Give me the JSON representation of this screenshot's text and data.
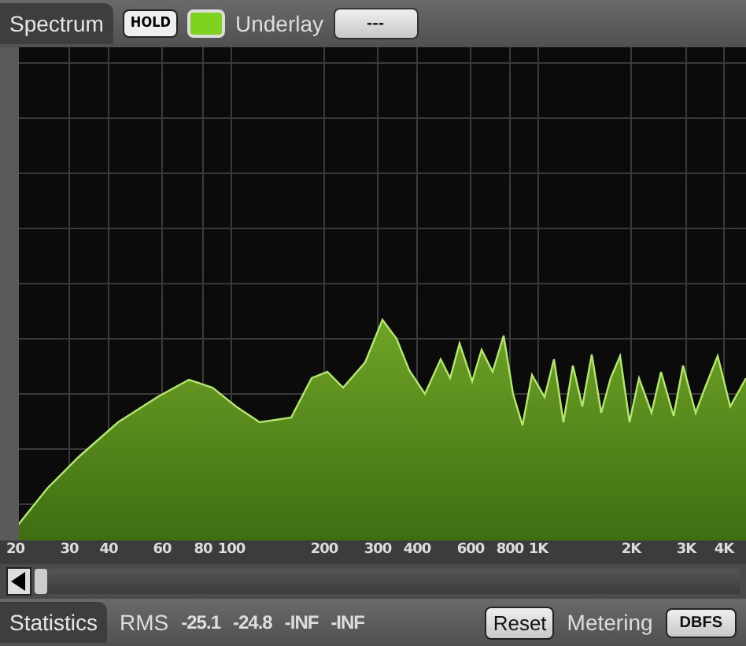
{
  "toolbar": {
    "title": "Spectrum",
    "hold_button": "HOLD",
    "hold_indicator": {
      "on": true
    },
    "underlay_label": "Underlay",
    "underlay_button": "---"
  },
  "plot": {
    "frequency_labels": [
      "20",
      "30",
      "40",
      "60",
      "80",
      "100",
      "200",
      "300",
      "400",
      "600",
      "800",
      "1K",
      "2K",
      "3K",
      "4K"
    ]
  },
  "statistics": {
    "title": "Statistics",
    "rms_label": "RMS",
    "values": [
      "-25.1",
      "-24.8",
      "-INF",
      "-INF"
    ],
    "reset_button": "Reset",
    "metering_label": "Metering",
    "metering_button": "DBFS"
  }
}
